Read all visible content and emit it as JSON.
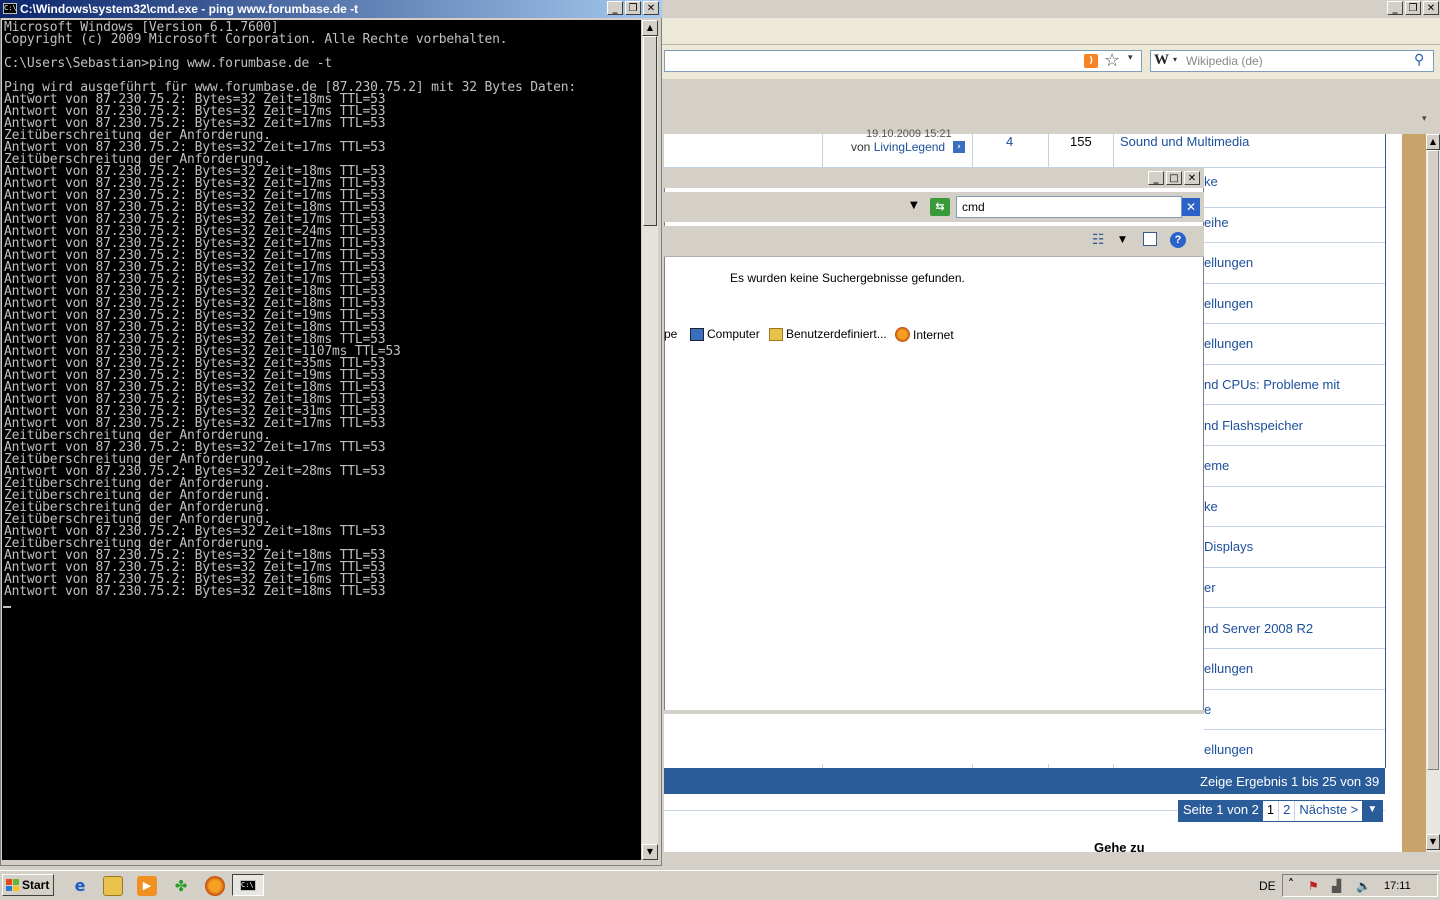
{
  "cmd": {
    "title": "C:\\Windows\\system32\\cmd.exe - ping  www.forumbase.de -t",
    "lines": [
      "Microsoft Windows [Version 6.1.7600]",
      "Copyright (c) 2009 Microsoft Corporation. Alle Rechte vorbehalten.",
      "",
      "C:\\Users\\Sebastian>ping www.forumbase.de -t",
      "",
      "Ping wird ausgeführt für www.forumbase.de [87.230.75.2] mit 32 Bytes Daten:",
      "Antwort von 87.230.75.2: Bytes=32 Zeit=18ms TTL=53",
      "Antwort von 87.230.75.2: Bytes=32 Zeit=17ms TTL=53",
      "Antwort von 87.230.75.2: Bytes=32 Zeit=17ms TTL=53",
      "Zeitüberschreitung der Anforderung.",
      "Antwort von 87.230.75.2: Bytes=32 Zeit=17ms TTL=53",
      "Zeitüberschreitung der Anforderung.",
      "Antwort von 87.230.75.2: Bytes=32 Zeit=18ms TTL=53",
      "Antwort von 87.230.75.2: Bytes=32 Zeit=17ms TTL=53",
      "Antwort von 87.230.75.2: Bytes=32 Zeit=17ms TTL=53",
      "Antwort von 87.230.75.2: Bytes=32 Zeit=18ms TTL=53",
      "Antwort von 87.230.75.2: Bytes=32 Zeit=17ms TTL=53",
      "Antwort von 87.230.75.2: Bytes=32 Zeit=24ms TTL=53",
      "Antwort von 87.230.75.2: Bytes=32 Zeit=17ms TTL=53",
      "Antwort von 87.230.75.2: Bytes=32 Zeit=17ms TTL=53",
      "Antwort von 87.230.75.2: Bytes=32 Zeit=17ms TTL=53",
      "Antwort von 87.230.75.2: Bytes=32 Zeit=17ms TTL=53",
      "Antwort von 87.230.75.2: Bytes=32 Zeit=18ms TTL=53",
      "Antwort von 87.230.75.2: Bytes=32 Zeit=18ms TTL=53",
      "Antwort von 87.230.75.2: Bytes=32 Zeit=19ms TTL=53",
      "Antwort von 87.230.75.2: Bytes=32 Zeit=18ms TTL=53",
      "Antwort von 87.230.75.2: Bytes=32 Zeit=18ms TTL=53",
      "Antwort von 87.230.75.2: Bytes=32 Zeit=1107ms TTL=53",
      "Antwort von 87.230.75.2: Bytes=32 Zeit=35ms TTL=53",
      "Antwort von 87.230.75.2: Bytes=32 Zeit=19ms TTL=53",
      "Antwort von 87.230.75.2: Bytes=32 Zeit=18ms TTL=53",
      "Antwort von 87.230.75.2: Bytes=32 Zeit=18ms TTL=53",
      "Antwort von 87.230.75.2: Bytes=32 Zeit=31ms TTL=53",
      "Antwort von 87.230.75.2: Bytes=32 Zeit=17ms TTL=53",
      "Zeitüberschreitung der Anforderung.",
      "Antwort von 87.230.75.2: Bytes=32 Zeit=17ms TTL=53",
      "Zeitüberschreitung der Anforderung.",
      "Antwort von 87.230.75.2: Bytes=32 Zeit=28ms TTL=53",
      "Zeitüberschreitung der Anforderung.",
      "Zeitüberschreitung der Anforderung.",
      "Zeitüberschreitung der Anforderung.",
      "Zeitüberschreitung der Anforderung.",
      "Antwort von 87.230.75.2: Bytes=32 Zeit=18ms TTL=53",
      "Zeitüberschreitung der Anforderung.",
      "Antwort von 87.230.75.2: Bytes=32 Zeit=18ms TTL=53",
      "Antwort von 87.230.75.2: Bytes=32 Zeit=17ms TTL=53",
      "Antwort von 87.230.75.2: Bytes=32 Zeit=16ms TTL=53",
      "Antwort von 87.230.75.2: Bytes=32 Zeit=18ms TTL=53"
    ]
  },
  "browser": {
    "search_placeholder": "Wikipedia (de)",
    "search_engine_icon": "W",
    "forum": {
      "first_row": {
        "date": "19.10.2009 15:21",
        "by_prefix": "von",
        "by_user": "LivingLegend",
        "replies": "4",
        "views": "155",
        "forum_name": "Sound und Multimedia"
      },
      "forum_links": [
        "ke",
        "eihe",
        "ellungen",
        "ellungen",
        "ellungen",
        "nd CPUs: Probleme mit",
        "nd Flashspeicher",
        "eme",
        "ke",
        " Displays",
        "er",
        "nd Server 2008 R2",
        "ellungen",
        "e",
        "ellungen"
      ],
      "results_text": "Zeige Ergebnis 1 bis 25 von 39",
      "pager": {
        "label": "Seite 1 von 2",
        "current": "1",
        "page2": "2",
        "next": "Nächste >"
      },
      "goto_label": "Gehe zu"
    }
  },
  "explorer": {
    "search_value": "cmd",
    "no_results": "Es wurden keine Suchergebnisse gefunden.",
    "locations": [
      {
        "label": "pe",
        "icon": "library-icon"
      },
      {
        "label": "Computer",
        "icon": "computer-icon"
      },
      {
        "label": "Benutzerdefiniert...",
        "icon": "folder-icon"
      },
      {
        "label": "Internet",
        "icon": "firefox-icon"
      }
    ]
  },
  "taskbar": {
    "start_label": "Start",
    "language": "DE",
    "clock": "17:11"
  },
  "colors": {
    "console_bg": "#000000",
    "console_fg": "#c0c0c0",
    "title_active": "#0a246a",
    "forum_link": "#1c4f9c",
    "forum_bar": "#2a5c9a"
  }
}
